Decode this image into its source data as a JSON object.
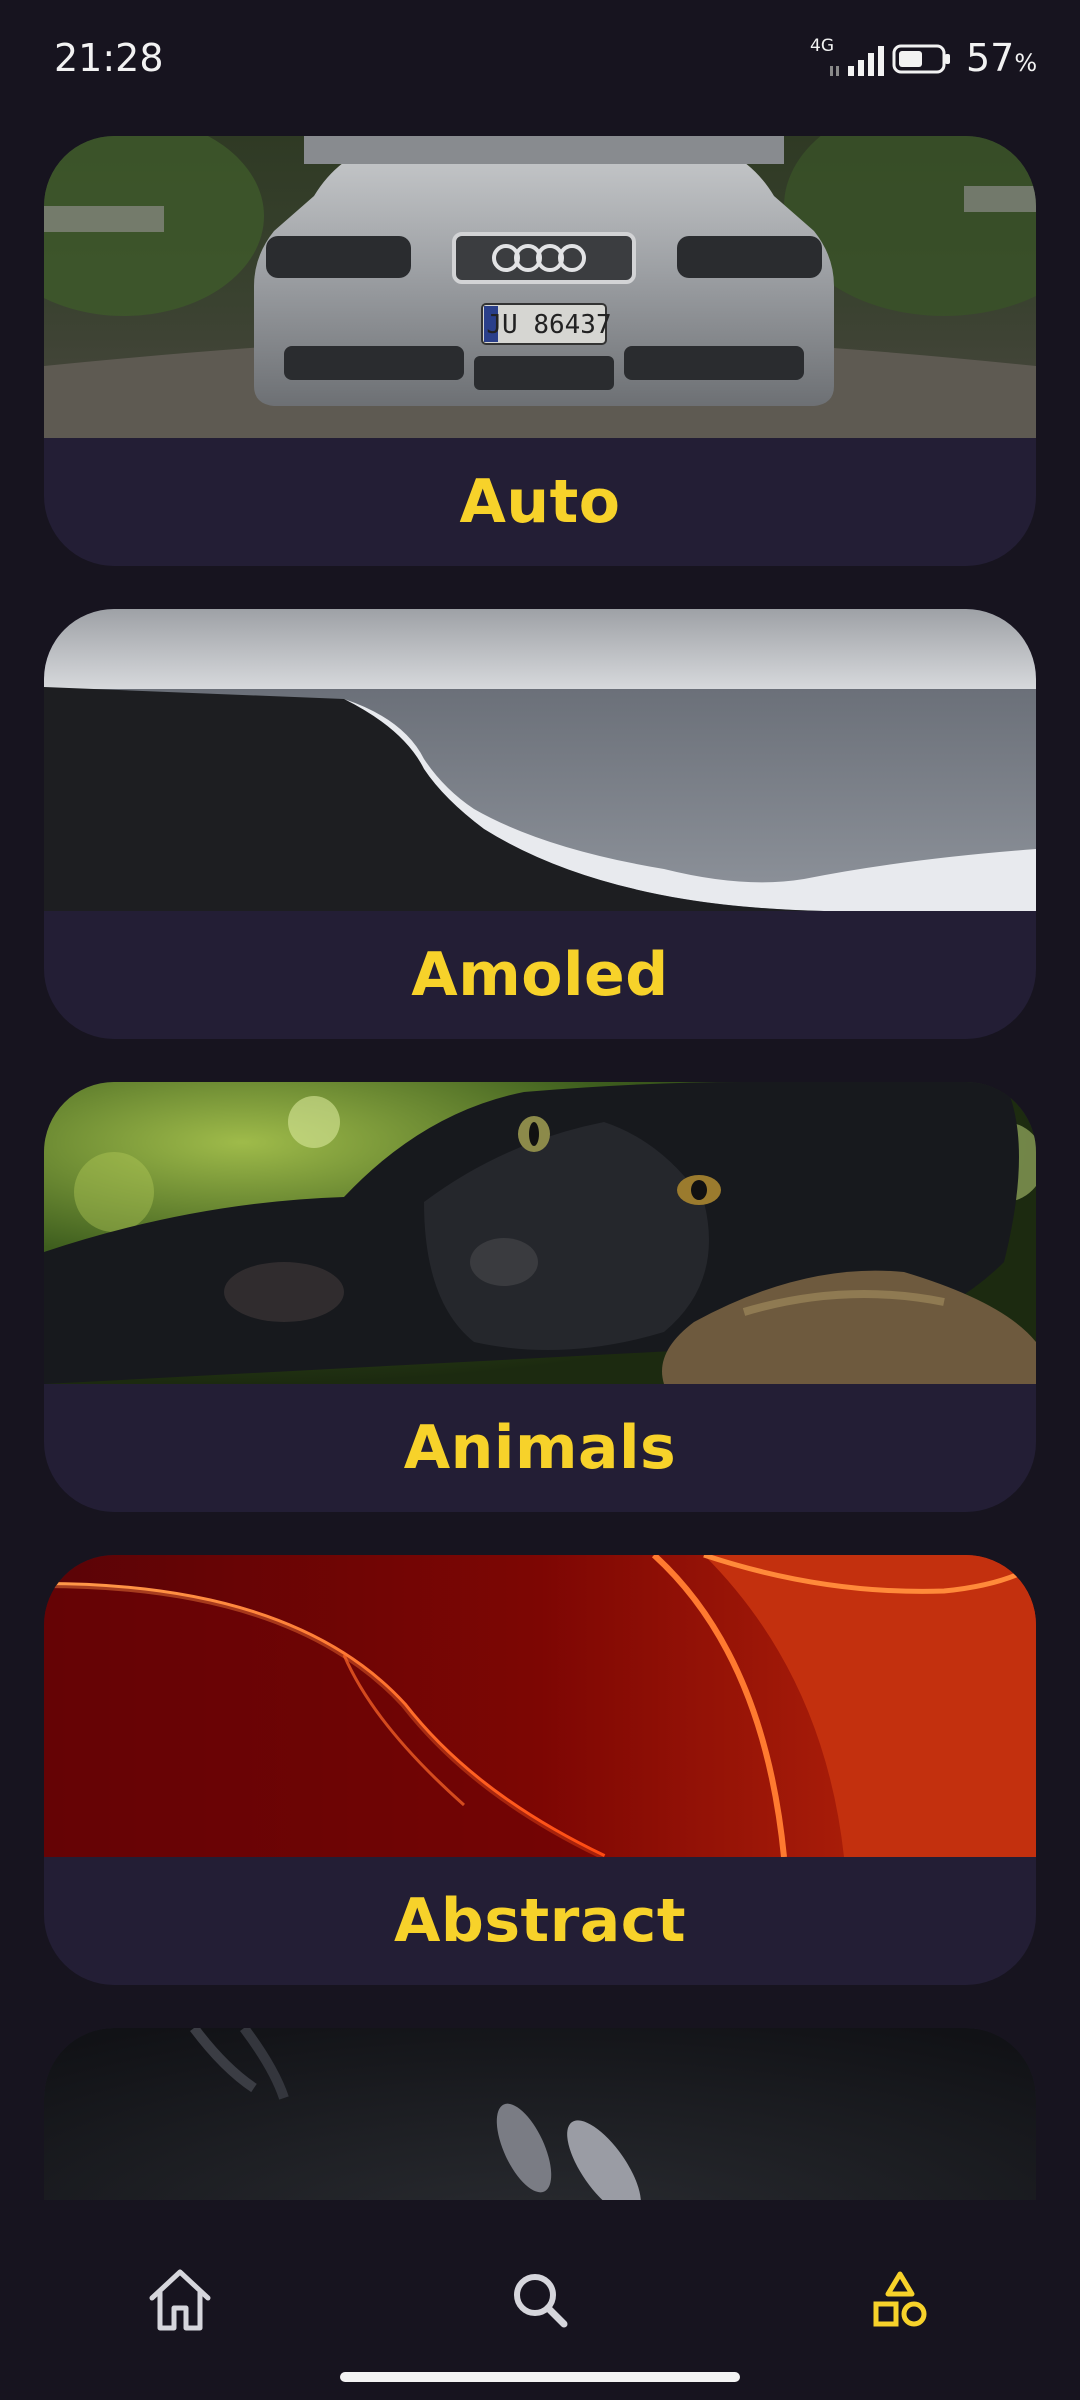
{
  "status_bar": {
    "time": "21:28",
    "network": "4G",
    "battery_value": "57",
    "battery_unit": "%",
    "battery_level": 0.57,
    "icons": [
      "signal-icon",
      "battery-icon"
    ]
  },
  "categories": [
    {
      "label": "Auto",
      "image": "silver-car-front-photo"
    },
    {
      "label": "Amoled",
      "image": "dark-beach-waves-photo"
    },
    {
      "label": "Animals",
      "image": "black-panther-photo"
    },
    {
      "label": "Abstract",
      "image": "red-curves-abstract-photo"
    },
    {
      "label": "",
      "image": "dark-fish-photo"
    }
  ],
  "bottom_nav": {
    "items": [
      {
        "icon": "home-icon",
        "active": false
      },
      {
        "icon": "search-icon",
        "active": false
      },
      {
        "icon": "shapes-icon",
        "active": true
      }
    ],
    "colors": {
      "active": "#f7d22a",
      "inactive": "#d6d6dc"
    }
  },
  "colors": {
    "background": "#17141f",
    "card": "#231e35",
    "accent": "#f7d22a"
  }
}
